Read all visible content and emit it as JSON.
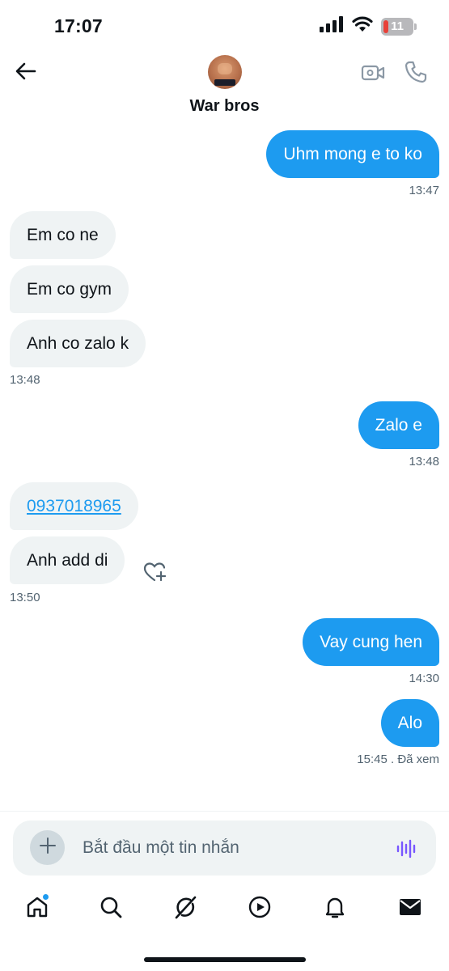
{
  "status_bar": {
    "time": "17:07",
    "battery": "11",
    "icons": [
      "signal-icon",
      "wifi-icon",
      "battery-icon"
    ]
  },
  "header": {
    "title": "War bros",
    "icons": [
      "back-arrow-icon",
      "avatar",
      "video-camera-icon",
      "phone-icon"
    ]
  },
  "messages": [
    {
      "side": "sent",
      "text": "Uhm mong e to ko"
    },
    {
      "time": "13:47"
    },
    {
      "side": "received",
      "text": "Em co ne"
    },
    {
      "side": "received",
      "text": "Em co gym"
    },
    {
      "side": "received",
      "text": "Anh co zalo k"
    },
    {
      "time": "13:48"
    },
    {
      "side": "sent",
      "text": "Zalo e"
    },
    {
      "time": "13:48"
    },
    {
      "side": "received",
      "text": "0937018965",
      "is_link": true
    },
    {
      "side": "received",
      "text": "Anh add di"
    },
    {
      "time": "13:50"
    },
    {
      "side": "sent",
      "text": "Vay cung hen"
    },
    {
      "time": "14:30"
    },
    {
      "side": "sent",
      "text": "Alo"
    },
    {
      "time": "15:45 . Đã xem"
    }
  ],
  "composer": {
    "placeholder": "Bắt đầu một tin nhắn",
    "icons": [
      "plus-icon",
      "voice-icon"
    ]
  },
  "tabbar": {
    "items": [
      "home-icon",
      "search-icon",
      "grok-icon",
      "play-icon",
      "notifications-icon",
      "messages-icon"
    ]
  },
  "colors": {
    "accent": "#1d9bf0",
    "bubble_received": "#eff3f4",
    "text": "#0f1419",
    "muted": "#536471",
    "voice": "#7856ff"
  }
}
